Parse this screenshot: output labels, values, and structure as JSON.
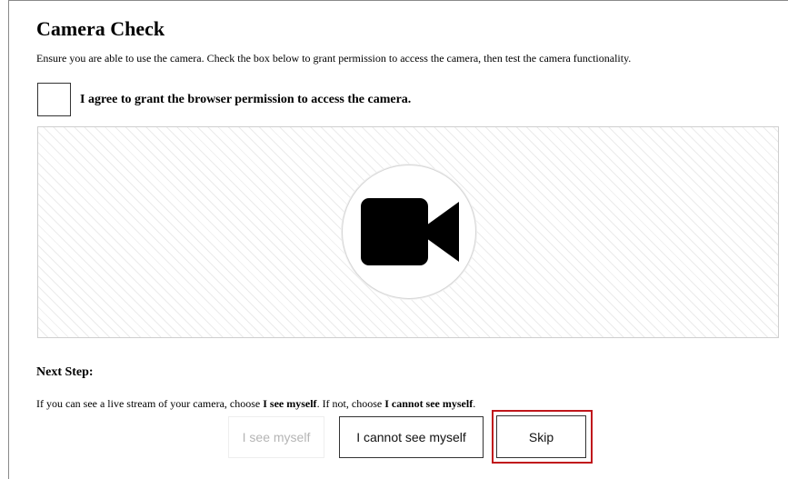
{
  "page": {
    "title": "Camera Check",
    "intro": "Ensure you are able to use the camera. Check the box below to grant permission to access the camera, then test the camera functionality."
  },
  "permission": {
    "checked": false,
    "label": "I agree to grant the browser permission to access the camera."
  },
  "preview": {
    "icon": "video-camera-icon"
  },
  "next_step": {
    "heading": "Next Step:",
    "instruction_prefix": "If you can see a live stream of your camera, choose ",
    "option_see": "I see myself",
    "instruction_middle": ". If not, choose ",
    "option_cannot": "I cannot see myself",
    "instruction_suffix": "."
  },
  "buttons": {
    "see_myself": "I see myself",
    "see_myself_disabled": true,
    "cannot_see_myself": "I cannot see myself",
    "skip": "Skip"
  },
  "colors": {
    "highlight": "#c0161b",
    "disabled_text": "#b5b5b5",
    "border": "#333333"
  }
}
